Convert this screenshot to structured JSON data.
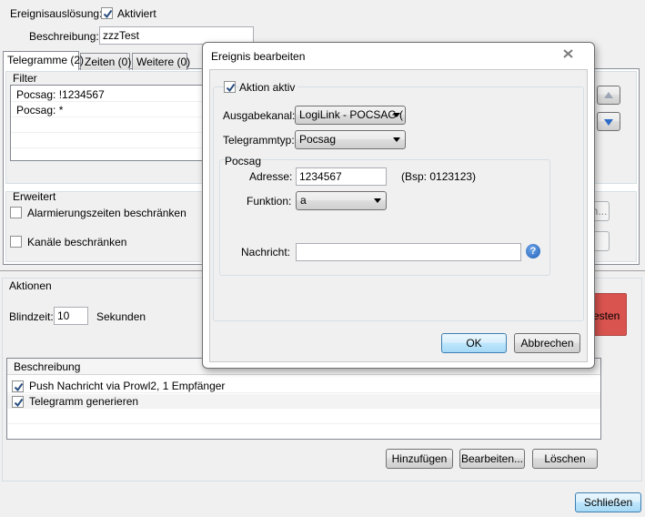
{
  "main": {
    "trigger_label": "Ereignisauslösung:",
    "trigger_checkbox_label": "Aktiviert",
    "description_label": "Beschreibung:",
    "description_value": "zzzTest",
    "tabs": [
      {
        "label": "Telegramme (2)"
      },
      {
        "label": "Zeiten (0)"
      },
      {
        "label": "Weitere (0)"
      }
    ],
    "filter": {
      "title": "Filter",
      "rows": [
        "Pocsag: !1234567",
        "Pocsag: *"
      ]
    },
    "extended": {
      "title": "Erweitert",
      "alarm_times_label": "Alarmierungszeiten beschränken",
      "channels_label": "Kanäle beschränken"
    },
    "actions": {
      "title": "Aktionen",
      "blind_label": "Blindzeit:",
      "blind_value": "10",
      "seconds_label": "Sekunden",
      "test_button_fragment": "esten",
      "side_button_fragment": "n...",
      "list_header": "Beschreibung",
      "rows": [
        "Push Nachricht via Prowl2, 1 Empfänger",
        "Telegramm generieren"
      ],
      "add_label": "Hinzufügen",
      "edit_label": "Bearbeiten...",
      "delete_label": "Löschen"
    },
    "close_label": "Schließen"
  },
  "dialog": {
    "title": "Ereignis bearbeiten",
    "action_active_label": "Aktion aktiv",
    "output_channel_label": "Ausgabekanal:",
    "output_channel_value": "LogiLink - POCSAG (",
    "telegram_type_label": "Telegrammtyp:",
    "telegram_type_value": "Pocsag",
    "pocsag_group_title": "Pocsag",
    "address_label": "Adresse:",
    "address_value": "1234567",
    "address_hint": "(Bsp: 0123123)",
    "function_label": "Funktion:",
    "function_value": "a",
    "message_label": "Nachricht:",
    "message_value": "",
    "ok_label": "OK",
    "cancel_label": "Abbrechen"
  },
  "colors": {
    "accent": "#3c7fb1",
    "test_button": "#d9534f",
    "close_hover": "#c75050"
  }
}
